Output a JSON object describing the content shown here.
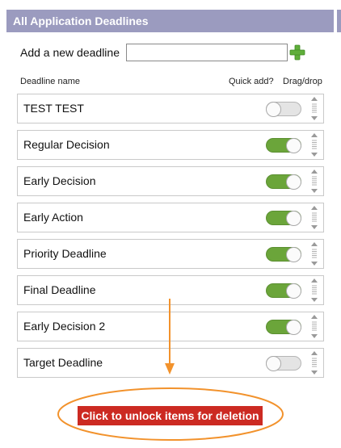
{
  "header": {
    "title": "All Application Deadlines"
  },
  "add": {
    "label": "Add a new deadline",
    "value": "",
    "placeholder": ""
  },
  "columns": {
    "name": "Deadline name",
    "quick_add": "Quick add?",
    "drag": "Drag/drop"
  },
  "deadlines": [
    {
      "label": "TEST TEST",
      "quick_add": false
    },
    {
      "label": "Regular Decision",
      "quick_add": true
    },
    {
      "label": "Early Decision",
      "quick_add": true
    },
    {
      "label": "Early Action",
      "quick_add": true
    },
    {
      "label": "Priority Deadline",
      "quick_add": true
    },
    {
      "label": "Final Deadline",
      "quick_add": true
    },
    {
      "label": "Early Decision 2",
      "quick_add": true
    },
    {
      "label": "Target Deadline",
      "quick_add": false
    }
  ],
  "unlock_button": {
    "label": "Click to unlock items for deletion"
  },
  "colors": {
    "header": "#9b9bbf",
    "toggle_on": "#6ba53a",
    "toggle_off": "#e4e4e4",
    "unlock": "#cc2a22",
    "annotation": "#f2922c",
    "plus": "#5fae3a"
  }
}
